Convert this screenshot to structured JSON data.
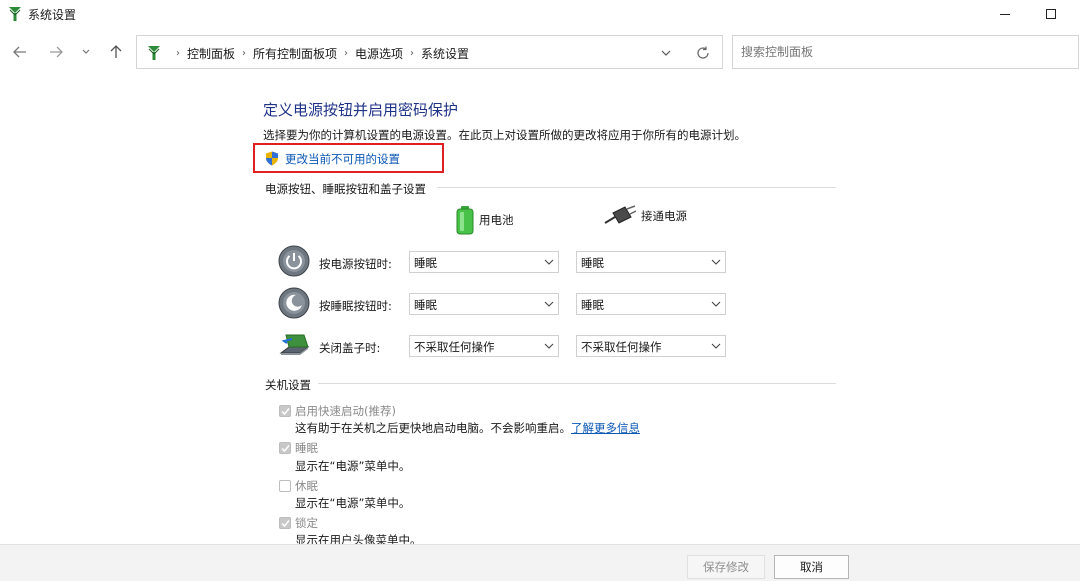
{
  "window": {
    "title": "系统设置"
  },
  "address": {
    "crumbs": [
      "控制面板",
      "所有控制面板项",
      "电源选项",
      "系统设置"
    ],
    "separator": "›"
  },
  "search": {
    "placeholder": "搜索控制面板"
  },
  "main": {
    "title": "定义电源按钮并启用密码保护",
    "description": "选择要为你的计算机设置的电源设置。在此页上对设置所做的更改将应用于你所有的电源计划。",
    "change_link": "更改当前不可用的设置"
  },
  "power_buttons": {
    "section_title": "电源按钮、睡眠按钮和盖子设置",
    "col_battery": "用电池",
    "col_plugged": "接通电源",
    "rows": [
      {
        "label": "按电源按钮时:",
        "battery": "睡眠",
        "plugged": "睡眠"
      },
      {
        "label": "按睡眠按钮时:",
        "battery": "睡眠",
        "plugged": "睡眠"
      },
      {
        "label": "关闭盖子时:",
        "battery": "不采取任何操作",
        "plugged": "不采取任何操作"
      }
    ]
  },
  "shutdown": {
    "section_title": "关机设置",
    "items": [
      {
        "label": "启用快速启动(推荐)",
        "checked": true,
        "desc": "这有助于在关机之后更快地启动电脑。不会影响重启。",
        "link": "了解更多信息"
      },
      {
        "label": "睡眠",
        "checked": true,
        "desc": "显示在“电源”菜单中。"
      },
      {
        "label": "休眠",
        "checked": false,
        "desc": "显示在“电源”菜单中。"
      },
      {
        "label": "锁定",
        "checked": true,
        "desc": "显示在用户头像菜单中。"
      }
    ]
  },
  "footer": {
    "save": "保存修改",
    "cancel": "取消"
  },
  "colors": {
    "title": "#1e3287",
    "link": "#0a57b5",
    "highlight": "#e02020",
    "footer_bg": "#f3f3f3"
  }
}
